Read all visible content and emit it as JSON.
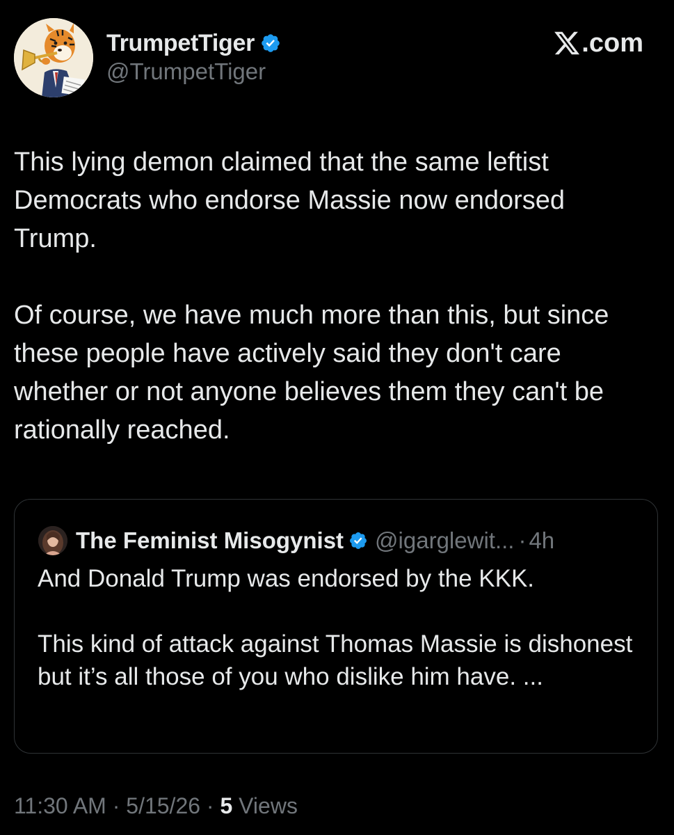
{
  "author": {
    "display_name": "TrumpetTiger",
    "handle": "@TrumpetTiger",
    "verified": true,
    "avatar_icon": "tiger-playing-trumpet-avatar"
  },
  "brand": {
    "logo_icon": "x-logo-icon",
    "label": ".com"
  },
  "tweet": {
    "paragraphs": [
      "This lying demon claimed that the same leftist Democrats who endorse Massie now endorsed Trump.",
      "Of course, we have much more than this, but since these people have actively said they don't care whether or not anyone believes them they can't be rationally reached."
    ]
  },
  "quoted_tweet": {
    "display_name": "The Feminist Misogynist",
    "handle": "@igarglewit...",
    "separator": "·",
    "time": "4h",
    "verified": true,
    "paragraphs": [
      "And Donald Trump was endorsed by the KKK.",
      "This kind of attack against Thomas Massie is dishonest but it’s all those of you who dislike him have. ..."
    ]
  },
  "meta": {
    "time": "11:30 AM",
    "sep1": "·",
    "date": "5/15/26",
    "sep2": "·",
    "views_count": "5",
    "views_label": "Views"
  },
  "colors": {
    "background": "#000000",
    "primary_text": "#e7e9ea",
    "secondary_text": "#71767b",
    "verified_blue": "#1d9bf0",
    "border": "#2f3336"
  }
}
